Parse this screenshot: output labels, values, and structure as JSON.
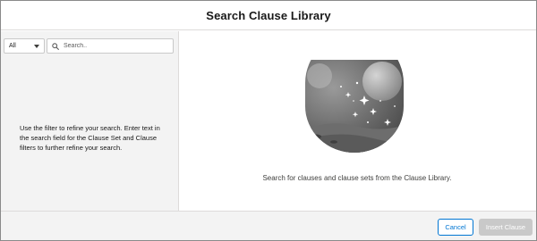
{
  "modal": {
    "title": "Search Clause Library"
  },
  "sidebar": {
    "filter": {
      "selected": "All",
      "icon": "chevron-down-icon"
    },
    "search": {
      "placeholder": "Search..",
      "value": "",
      "icon": "search-icon"
    },
    "help_text": "Use the filter to refine your search. Enter text in the search field for the Clause Set and Clause filters to further refine your search."
  },
  "main": {
    "illustration": "space-planet-illustration",
    "empty_state_text": "Search for clauses and clause sets from the Clause Library."
  },
  "footer": {
    "cancel_label": "Cancel",
    "insert_label": "Insert Clause"
  },
  "colors": {
    "brand": "#0176d3",
    "panel_background": "#f3f3f3",
    "disabled_button": "#c9c9c9",
    "border": "#dddbda"
  }
}
